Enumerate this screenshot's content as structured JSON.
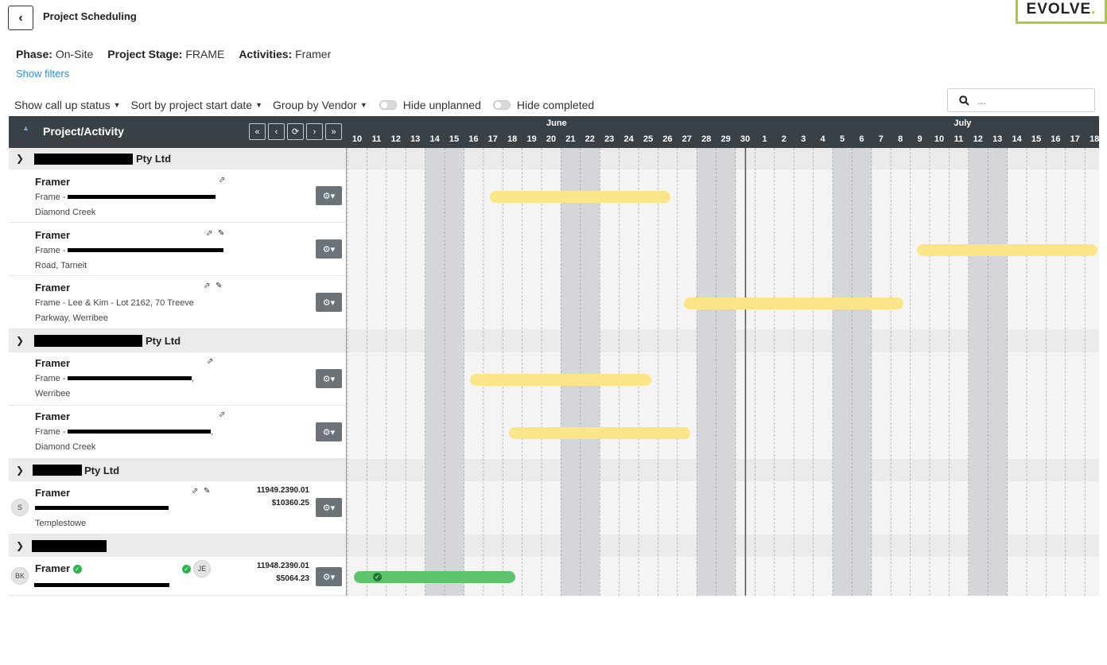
{
  "header": {
    "title": "Project Scheduling",
    "logo_text": "EVOLVE",
    "logo_dot": "."
  },
  "meta": {
    "phase_label": "Phase:",
    "phase_value": "On-Site",
    "stage_label": "Project Stage:",
    "stage_value": "FRAME",
    "activities_label": "Activities:",
    "activities_value": "Framer",
    "show_filters": "Show filters"
  },
  "toolbar": {
    "callup": "Show call up status",
    "sort": "Sort by project start date",
    "group": "Group by Vendor",
    "hide_unplanned": "Hide unplanned",
    "hide_completed": "Hide completed"
  },
  "search": {
    "placeholder": "..."
  },
  "grid": {
    "column_title": "Project/Activity",
    "nav": [
      "«",
      "‹",
      "⟳",
      "›",
      "»"
    ],
    "months": [
      {
        "label": "June",
        "day_index": 10
      },
      {
        "label": "July",
        "day_index": 31
      }
    ],
    "days": [
      "10",
      "11",
      "12",
      "13",
      "14",
      "15",
      "16",
      "17",
      "18",
      "19",
      "20",
      "21",
      "22",
      "23",
      "24",
      "25",
      "26",
      "27",
      "28",
      "29",
      "30",
      "1",
      "2",
      "3",
      "4",
      "5",
      "6",
      "7",
      "8",
      "9",
      "10",
      "11",
      "12",
      "13",
      "14",
      "15",
      "16",
      "17",
      "18"
    ],
    "weekend_indices": [
      4,
      5,
      11,
      12,
      18,
      19,
      25,
      26,
      32,
      33
    ],
    "today_index": 21
  },
  "groups": [
    {
      "name_suffix": "Pty Ltd",
      "activities": [
        {
          "title": "Framer",
          "line1": "Frame -",
          "line2": "Diamond Creek",
          "icons": [
            "share-icon"
          ],
          "bar": {
            "start": 7,
            "end": 16,
            "status": "planned"
          }
        },
        {
          "title": "Framer",
          "line1": "Frame -",
          "line2": "Road, Tarneit",
          "icons": [
            "share-icon",
            "pencil-icon"
          ],
          "bar": {
            "start": 29,
            "end": 38,
            "status": "planned"
          }
        },
        {
          "title": "Framer",
          "line1": "Frame - Lee & Kim - Lot 2162, 70 Treeve",
          "line2": "Parkway, Werribee",
          "icons": [
            "share-icon",
            "pencil-icon"
          ],
          "bar": {
            "start": 17,
            "end": 28,
            "status": "planned"
          }
        }
      ]
    },
    {
      "name_suffix": "Pty Ltd",
      "activities": [
        {
          "title": "Framer",
          "line1": "Frame -",
          "line1_tail": ",",
          "line2": "Werribee",
          "icons": [
            "share-icon"
          ],
          "bar": {
            "start": 6,
            "end": 15,
            "status": "planned"
          }
        },
        {
          "title": "Framer",
          "line1": "Frame -",
          "line1_tail": ",",
          "line2": "Diamond Creek",
          "icons": [
            "share-icon"
          ],
          "bar": {
            "start": 8,
            "end": 17,
            "status": "planned"
          }
        }
      ]
    },
    {
      "name_suffix": "Pty Ltd",
      "activities": [
        {
          "title": "Framer",
          "line2": "Templestowe",
          "avatar": "S",
          "amount_id": "11949.2390.01",
          "amount": "$10360.25",
          "icons": [
            "share-icon",
            "pencil-icon"
          ],
          "bar": null
        }
      ]
    },
    {
      "name_suffix": "",
      "activities": [
        {
          "title": "Framer",
          "avatar": "BK",
          "assignee": "JE",
          "amount_id": "11948.2390.01",
          "amount": "$5064.23",
          "completed": true,
          "bar": {
            "start": 0,
            "end": 8,
            "status": "completed"
          }
        }
      ]
    }
  ],
  "colors": {
    "planned_bar": "#fbe589",
    "completed_bar": "#5ec46c",
    "header_bg": "#3a4146",
    "weekend": "#d5d6d9",
    "accent": "#a7c93a",
    "link": "#2f8fd8"
  }
}
